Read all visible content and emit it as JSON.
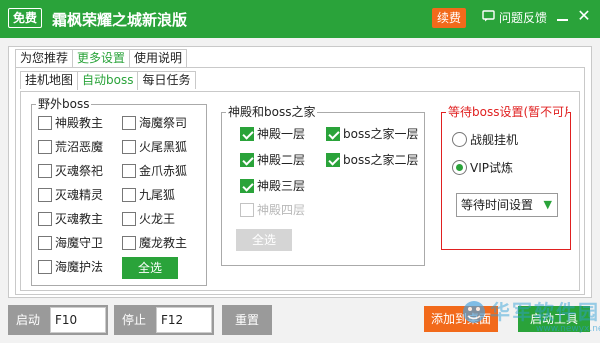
{
  "titlebar": {
    "free_badge": "免费",
    "title": "霜枫荣耀之城新浪版",
    "renew": "续费",
    "feedback": "问题反馈",
    "minimize": "—",
    "close": "✕"
  },
  "top_tabs": [
    "为您推荐",
    "更多设置",
    "使用说明"
  ],
  "sub_tabs": [
    "挂机地图",
    "自动boss",
    "每日任务"
  ],
  "wild_boss": {
    "legend": "野外boss",
    "col1": [
      "神殿教主",
      "荒沼恶魔",
      "灭魂祭祀",
      "灭魂精灵",
      "灭魂教主",
      "海魔守卫",
      "海魔护法"
    ],
    "col2": [
      "海魔祭司",
      "火尾黑狐",
      "金爪赤狐",
      "九尾狐",
      "火龙王",
      "魔龙教主"
    ],
    "select_all": "全选"
  },
  "temple": {
    "legend": "神殿和boss之家",
    "items": [
      {
        "label": "神殿一层",
        "checked": true,
        "disabled": false
      },
      {
        "label": "boss之家一层",
        "checked": true,
        "disabled": false
      },
      {
        "label": "神殿二层",
        "checked": true,
        "disabled": false
      },
      {
        "label": "boss之家二层",
        "checked": true,
        "disabled": false
      },
      {
        "label": "神殿三层",
        "checked": true,
        "disabled": false
      },
      {
        "label": "神殿四层",
        "checked": false,
        "disabled": true
      }
    ],
    "select_all": "全选"
  },
  "waiting": {
    "legend": "等待boss设置(暂不可用",
    "options": [
      "战舰挂机",
      "VIP试炼"
    ],
    "selected": "VIP试炼",
    "select_value": "等待时间设置",
    "accent": "#e02020"
  },
  "bottom": {
    "start_label": "启动",
    "start_key": "F10",
    "stop_label": "停止",
    "stop_key": "F12",
    "reset_label": "重置",
    "add_desktop": "添加到桌面",
    "start_tool": "启动工具"
  },
  "watermark": {
    "text": "华军软件园",
    "url": "www.newyx.net"
  },
  "colors": {
    "brand_green": "#2aa33a",
    "orange": "#f26a1b"
  }
}
